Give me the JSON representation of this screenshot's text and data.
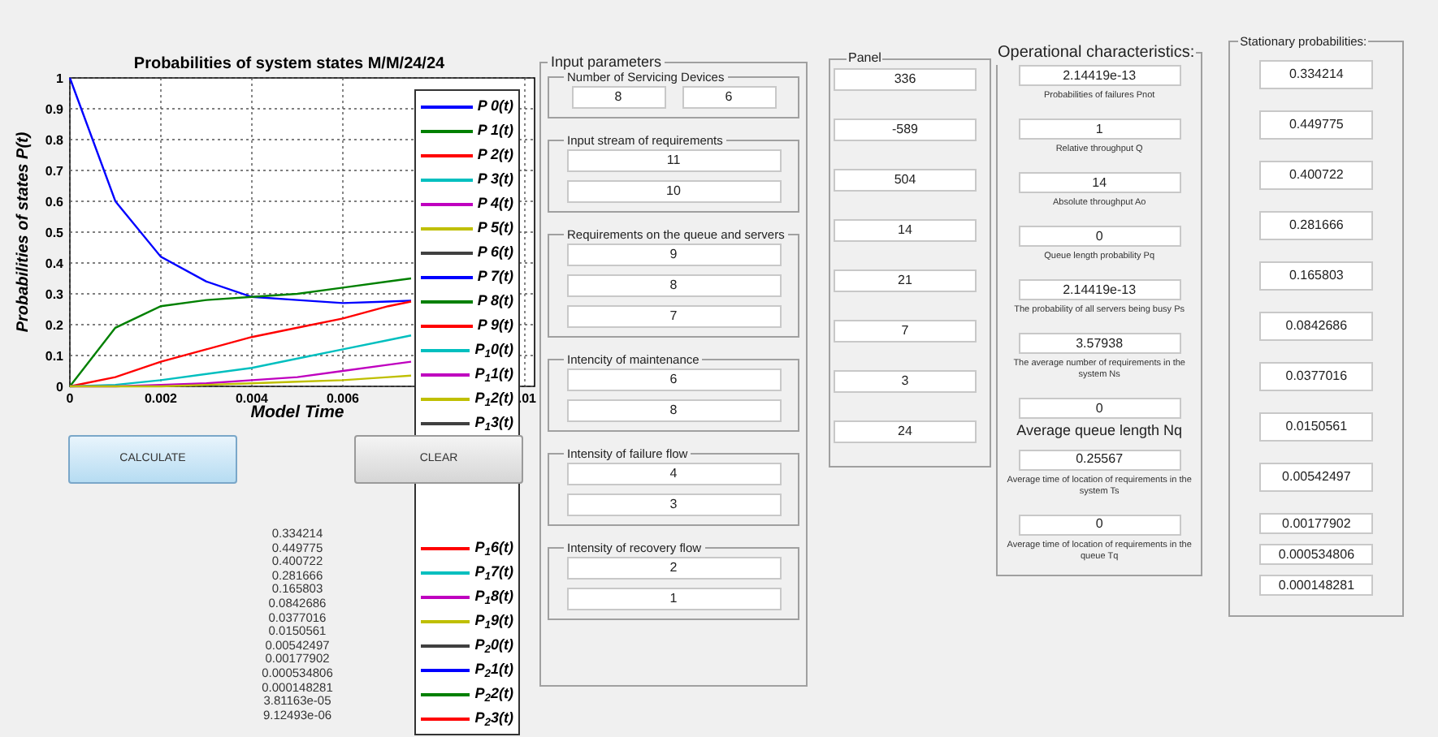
{
  "chart": {
    "chart_data": {
      "type": "line",
      "title": "Probabilities of system states M/M/24/24",
      "xlabel": "Model Time",
      "ylabel": "Probabilities of states P(t)",
      "grid": true,
      "x": [
        0,
        0.001,
        0.002,
        0.003,
        0.004,
        0.005,
        0.006,
        0.007,
        0.0075
      ],
      "xlim": [
        0,
        0.01
      ],
      "ylim": [
        0,
        1
      ],
      "xticks": [
        0,
        0.002,
        0.004,
        0.006,
        {
          "value": 0.01,
          "label": ".01"
        }
      ],
      "yticks": [
        0,
        0.1,
        0.2,
        0.3,
        0.4,
        0.5,
        0.6,
        0.7,
        0.8,
        0.9,
        1
      ],
      "series": [
        {
          "color": "#0000ff",
          "values": [
            1,
            0.6,
            0.42,
            0.34,
            0.29,
            0.28,
            0.27,
            0.275,
            0.278
          ]
        },
        {
          "color": "#008000",
          "values": [
            0,
            0.19,
            0.26,
            0.28,
            0.29,
            0.3,
            0.32,
            0.34,
            0.35
          ]
        },
        {
          "color": "#ff0000",
          "values": [
            0,
            0.03,
            0.08,
            0.12,
            0.16,
            0.19,
            0.22,
            0.26,
            0.275
          ]
        },
        {
          "color": "#00bfbf",
          "values": [
            0,
            0.005,
            0.02,
            0.04,
            0.06,
            0.09,
            0.12,
            0.15,
            0.165
          ]
        },
        {
          "color": "#bf00bf",
          "values": [
            0,
            0,
            0.005,
            0.01,
            0.02,
            0.03,
            0.05,
            0.07,
            0.08
          ]
        },
        {
          "color": "#bfbf00",
          "values": [
            0,
            0,
            0,
            0.005,
            0.01,
            0.015,
            0.02,
            0.03,
            0.035
          ]
        }
      ]
    },
    "legend_upper": [
      {
        "label": "P 0(t)",
        "color": "#0000ff"
      },
      {
        "label": "P 1(t)",
        "color": "#008000"
      },
      {
        "label": "P 2(t)",
        "color": "#ff0000"
      },
      {
        "label": "P 3(t)",
        "color": "#00bfbf"
      },
      {
        "label": "P 4(t)",
        "color": "#bf00bf"
      },
      {
        "label": "P 5(t)",
        "color": "#bfbf00"
      },
      {
        "label": "P 6(t)",
        "color": "#404040"
      },
      {
        "label": "P 7(t)",
        "color": "#0000ff"
      },
      {
        "label": "P 8(t)",
        "color": "#008000"
      },
      {
        "label": "P 9(t)",
        "color": "#ff0000"
      },
      {
        "label": "P$_{1}$0(t)",
        "color": "#00bfbf"
      },
      {
        "label": "P$_{1}$1(t)",
        "color": "#bf00bf"
      },
      {
        "label": "P$_{1}$2(t)",
        "color": "#bfbf00"
      },
      {
        "label": "P$_{1}$3(t)",
        "color": "#404040"
      }
    ],
    "legend_lower": [
      {
        "label": "P$_{1}$6(t)",
        "color": "#ff0000"
      },
      {
        "label": "P$_{1}$7(t)",
        "color": "#00bfbf"
      },
      {
        "label": "P$_{1}$8(t)",
        "color": "#bf00bf"
      },
      {
        "label": "P$_{1}$9(t)",
        "color": "#bfbf00"
      },
      {
        "label": "P$_{2}$0(t)",
        "color": "#404040"
      },
      {
        "label": "P$_{2}$1(t)",
        "color": "#0000ff"
      },
      {
        "label": "P$_{2}$2(t)",
        "color": "#008000"
      },
      {
        "label": "P$_{2}$3(t)",
        "color": "#ff0000"
      }
    ]
  },
  "buttons": [
    {
      "label": "CALCULATE",
      "kind": "primary"
    },
    {
      "label": "CLEAR",
      "kind": "secondary"
    }
  ],
  "result_list": [
    "0.334214",
    "0.449775",
    "0.400722",
    "0.281666",
    "0.165803",
    "0.0842686",
    "0.0377016",
    "0.0150561",
    "0.00542497",
    "0.00177902",
    "0.000534806",
    "0.000148281",
    "3.81163e-05",
    "9.12493e-06"
  ],
  "input_parameters": {
    "title": "Input parameters",
    "groups": [
      {
        "title": "Number of Servicing Devices",
        "kind": "row",
        "fields": [
          "8",
          "6"
        ]
      },
      {
        "title": "Input stream of requirements",
        "kind": "column",
        "fields": [
          "11",
          "10"
        ]
      },
      {
        "title": "Requirements on the queue and servers",
        "kind": "column",
        "fields": [
          "9",
          "8",
          "7"
        ]
      },
      {
        "title": "Intencity of maintenance",
        "kind": "column",
        "fields": [
          "6",
          "8"
        ]
      },
      {
        "title": "Intensity of failure flow",
        "kind": "column",
        "fields": [
          "4",
          "3"
        ]
      },
      {
        "title": "Intensity of recovery flow",
        "kind": "column",
        "fields": [
          "2",
          "1"
        ]
      }
    ]
  },
  "panel": {
    "title": "Panel",
    "fields": [
      "336",
      "-589",
      "504",
      "14",
      "21",
      "7",
      "3",
      "24"
    ]
  },
  "operational_characteristics": {
    "title": "Operational characteristics:",
    "items": [
      {
        "value": "2.14419e-13",
        "caption": "Probabilities of failures Pnot",
        "kind": "small"
      },
      {
        "value": "1",
        "caption": "Relative throughput Q",
        "kind": "small"
      },
      {
        "value": "14",
        "caption": "Absolute throughput Ao",
        "kind": "small"
      },
      {
        "value": "0",
        "caption": "Queue length probability Pq",
        "kind": "small"
      },
      {
        "value": "2.14419e-13",
        "caption": "The probability of all servers being busy Ps",
        "kind": "small"
      },
      {
        "value": "3.57938",
        "caption": "The average number of requirements in the system Ns",
        "kind": "small"
      },
      {
        "value": "0",
        "caption": "Average queue length Nq",
        "kind": "large"
      },
      {
        "value": "0.25567",
        "caption": "Average time of location of  requirements in the system Ts",
        "kind": "small"
      },
      {
        "value": "0",
        "caption": "Average time of location of requirements in the queue Tq",
        "kind": "small"
      }
    ]
  },
  "stationary_probabilities": {
    "title": "Stationary probabilities:",
    "fields": [
      "0.334214",
      "0.449775",
      "0.400722",
      "0.281666",
      "0.165803",
      "0.0842686",
      "0.0377016",
      "0.0150561",
      "0.00542497",
      "0.00177902",
      "0.000534806",
      "0.000148281"
    ]
  }
}
